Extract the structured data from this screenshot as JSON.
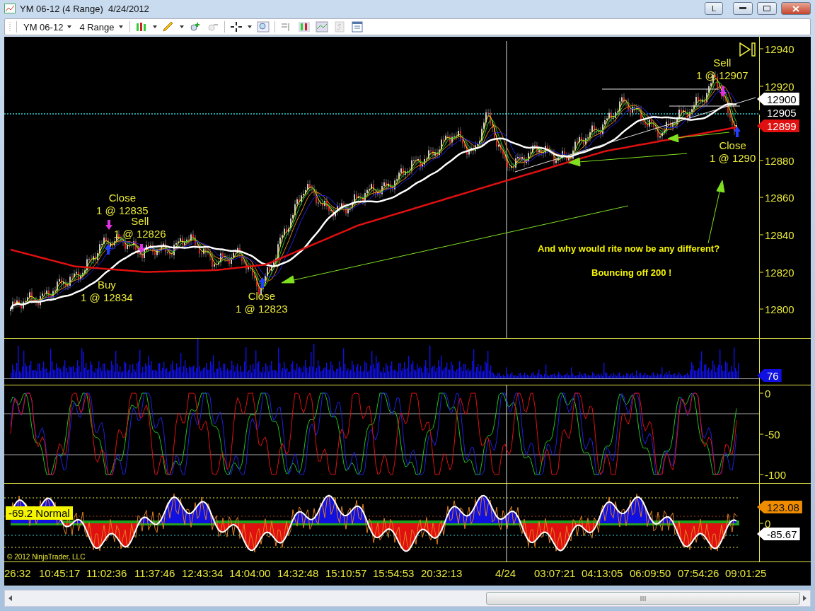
{
  "window": {
    "title": "YM 06-12 (4 Range)  4/24/2012",
    "layout_button": "L"
  },
  "toolbar": {
    "instrument": "YM 06-12",
    "interval": "4 Range"
  },
  "price_panel": {
    "axis_labels": [
      "12940",
      "12920",
      "12880",
      "12860",
      "12840",
      "12820",
      "12800"
    ],
    "markers": [
      {
        "text": "12900",
        "kind": "white"
      },
      {
        "text": "12905",
        "kind": "black"
      },
      {
        "text": "12899",
        "kind": "red"
      }
    ],
    "trades": [
      {
        "action": "Close",
        "detail": "1 @ 12835"
      },
      {
        "action": "Sell",
        "detail": "1 @ 12826"
      },
      {
        "action": "Buy",
        "detail": "1 @ 12834"
      },
      {
        "action": "Close",
        "detail": "1 @ 12823"
      },
      {
        "action": "Sell",
        "detail": "1 @ 12907"
      },
      {
        "action": "Close",
        "detail": "1 @ 1290"
      }
    ],
    "annotations": [
      "And why would rite now be any different?",
      "Bouncing off 200 !"
    ]
  },
  "volume_panel": {
    "marker": "76"
  },
  "stochastic_panel": {
    "axis_labels": [
      "0",
      "-50",
      "-100"
    ]
  },
  "cci_panel": {
    "axis_labels": [
      "0"
    ],
    "markers": [
      {
        "text": "123.08",
        "kind": "orange"
      },
      {
        "text": "-85.67",
        "kind": "white"
      }
    ],
    "status": "-69.2 Normal",
    "copyright": "© 2012 NinjaTrader, LLC"
  },
  "time_axis": [
    "26:32",
    "10:45:17",
    "11:02:36",
    "11:37:46",
    "12:43:34",
    "14:04:00",
    "14:32:48",
    "15:10:57",
    "15:54:53",
    "20:32:13",
    "4/24",
    "03:07:21",
    "04:13:05",
    "06:09:50",
    "07:54:26",
    "09:01:25"
  ]
}
